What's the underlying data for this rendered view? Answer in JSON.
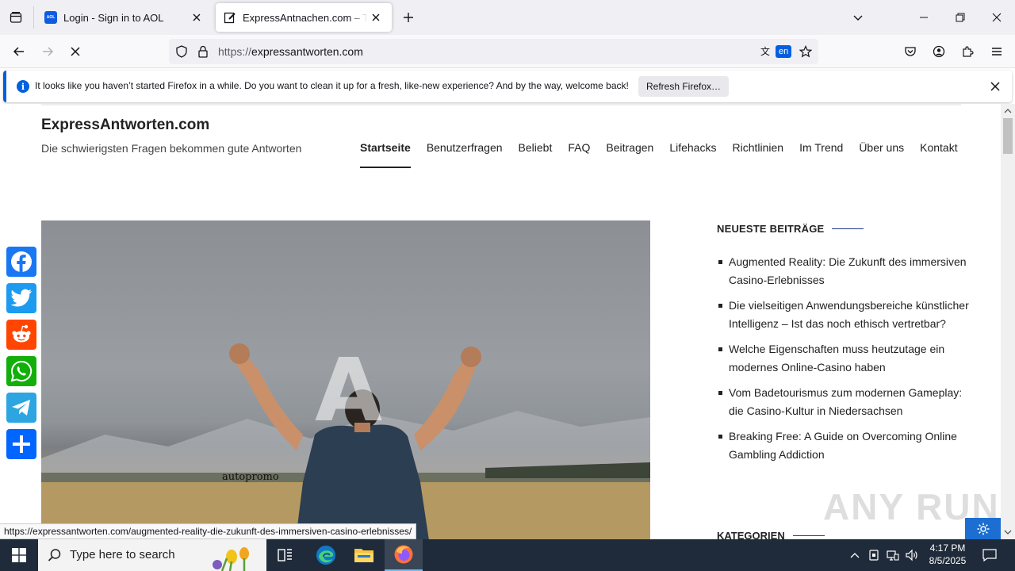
{
  "browser": {
    "tabs": [
      {
        "title": "Login - Sign in to AOL",
        "favicon": "aol-favicon"
      },
      {
        "title": "ExpressAntnachen.com – The m",
        "favicon": "edit-favicon"
      }
    ],
    "url_prefix": "https://",
    "url_host": "expressantworten.com",
    "translate_badge": "en"
  },
  "notification": {
    "message": "It looks like you haven’t started Firefox in a while. Do you want to clean it up for a fresh, like-new experience? And by the way, welcome back!",
    "button": "Refresh Firefox…"
  },
  "site": {
    "title": "ExpressAntworten.com",
    "description": "Die schwierigsten Fragen bekommen gute Antworten",
    "menu": [
      "Startseite",
      "Benutzerfragen",
      "Beliebt",
      "FAQ",
      "Beitragen",
      "Lifehacks",
      "Richtlinien",
      "Im Trend",
      "Über uns",
      "Kontakt"
    ],
    "hero_letter": "A",
    "hero_promo": "autopromo",
    "sidebar": {
      "recent_title": "NEUESTE BEITRÄGE",
      "recent_posts": [
        "Augmented Reality: Die Zukunft des immersiven Casino-Erlebnisses",
        "Die vielseitigen Anwendungsbereiche künstlicher Intelligenz – Ist das noch ethisch vertretbar?",
        "Welche Eigenschaften muss heutzutage ein modernes Online-Casino haben",
        "Vom Badetourismus zum modernen Gameplay: die Casino-Kultur in Niedersachsen",
        "Breaking Free: A Guide on Overcoming Online Gambling Addiction"
      ],
      "categories_title": "KATEGORIEN"
    },
    "share_buttons": [
      {
        "name": "facebook",
        "color": "#1877f2"
      },
      {
        "name": "twitter",
        "color": "#1d9bf0"
      },
      {
        "name": "reddit",
        "color": "#ff4500"
      },
      {
        "name": "whatsapp",
        "color": "#12af0a"
      },
      {
        "name": "telegram",
        "color": "#2ca5e0"
      },
      {
        "name": "share",
        "color": "#0166ff"
      }
    ]
  },
  "status_url": "https://expressantworten.com/augmented-reality-die-zukunft-des-immersiven-casino-erlebnisses/",
  "watermark": "ANY RUN",
  "taskbar": {
    "search_placeholder": "Type here to search",
    "time": "4:17 PM",
    "date": "8/5/2025"
  }
}
